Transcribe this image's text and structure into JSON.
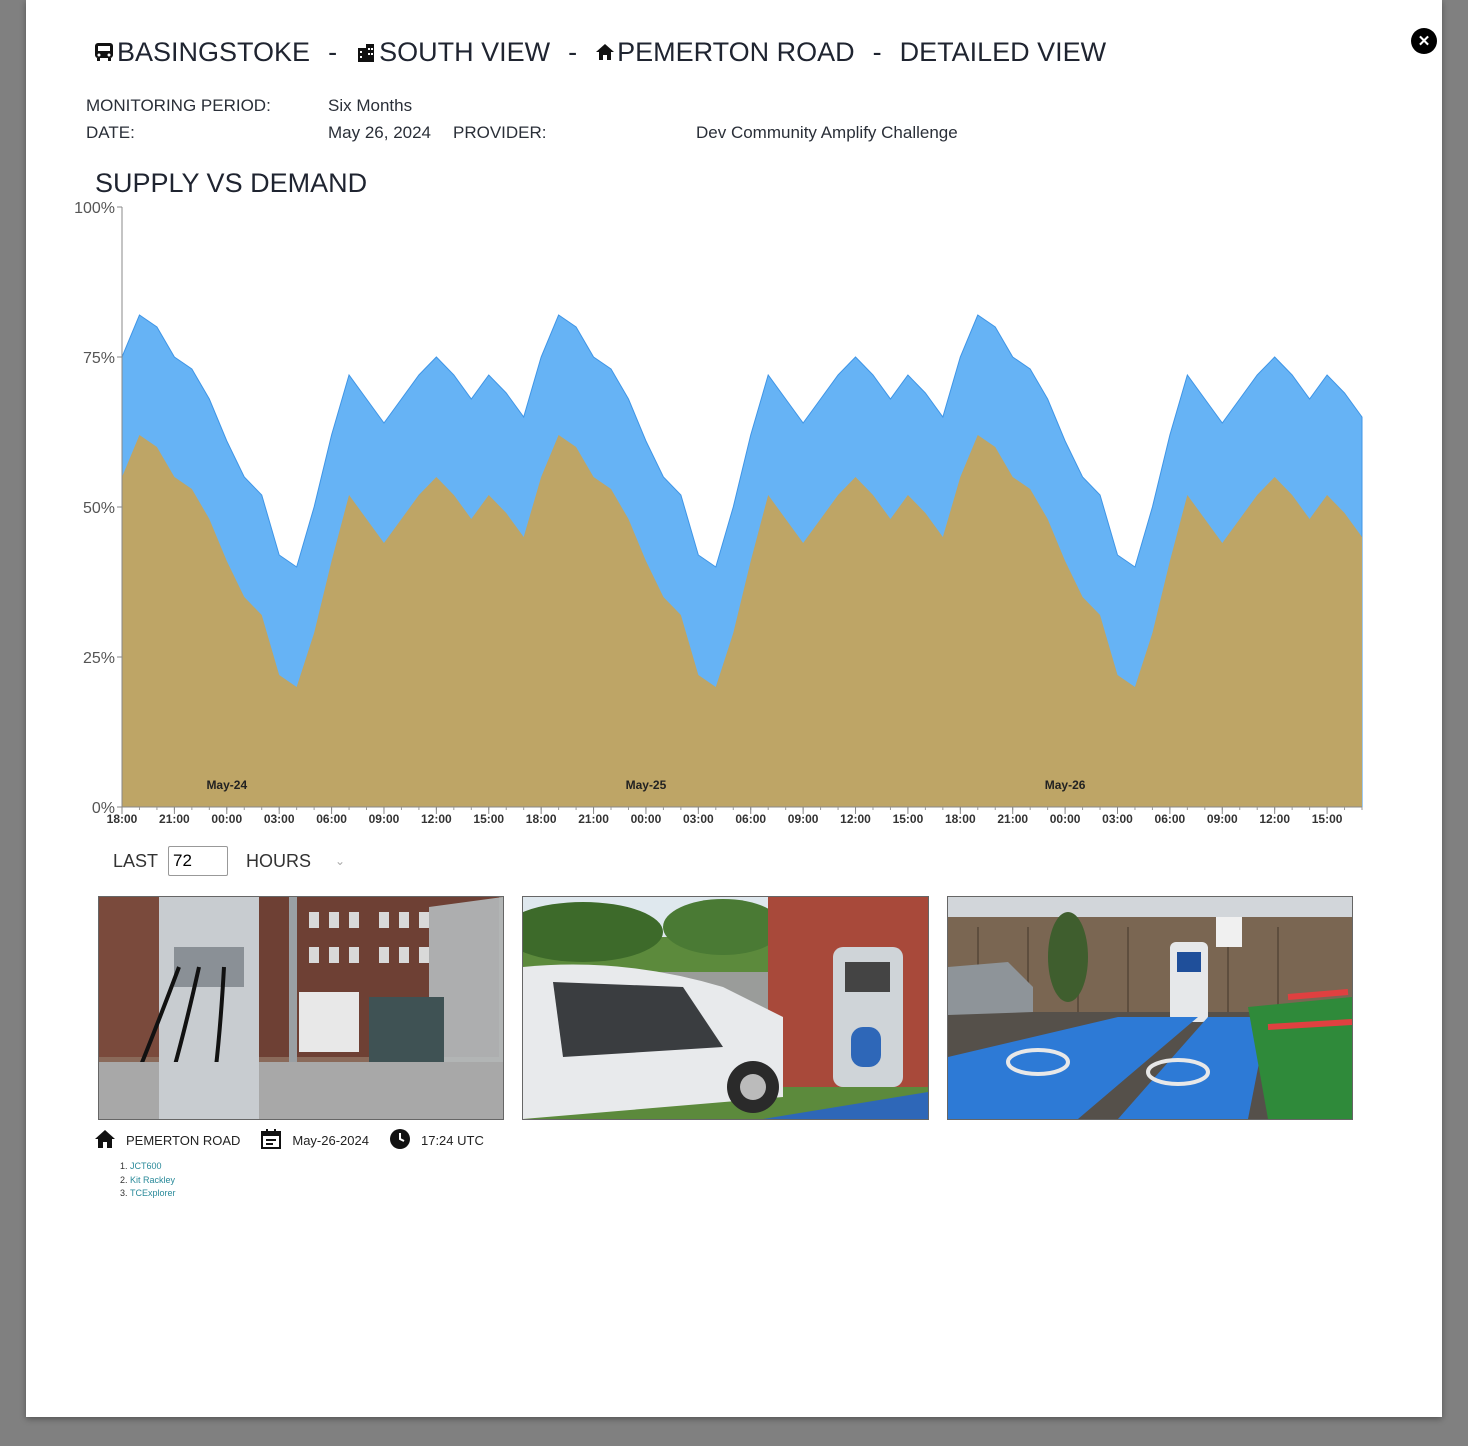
{
  "header": {
    "crumbs": [
      {
        "label": "BASINGSTOKE",
        "icon": "bus-icon"
      },
      {
        "label": "SOUTH VIEW",
        "icon": "city-icon"
      },
      {
        "label": "PEMERTON ROAD",
        "icon": "home-icon"
      }
    ],
    "separator": "-",
    "view_label": "DETAILED VIEW",
    "close_icon": "close-icon"
  },
  "meta": {
    "monitoring_period_label": "MONITORING PERIOD:",
    "monitoring_period_value": "Six Months",
    "date_label": "DATE:",
    "date_value": "May 26, 2024",
    "provider_label": "PROVIDER:",
    "provider_value": "Dev Community Amplify Challenge"
  },
  "chart_title": "SUPPLY VS DEMAND",
  "chart_data": {
    "type": "area",
    "title": "SUPPLY VS DEMAND",
    "ylim": [
      0,
      100
    ],
    "y_ticks": [
      "0%",
      "25%",
      "50%",
      "75%",
      "100%"
    ],
    "x_ticks": [
      "18:00",
      "21:00",
      "00:00",
      "03:00",
      "06:00",
      "09:00",
      "12:00",
      "15:00",
      "18:00",
      "21:00",
      "00:00",
      "03:00",
      "06:00",
      "09:00",
      "12:00",
      "15:00",
      "18:00",
      "21:00",
      "00:00",
      "03:00",
      "06:00",
      "09:00",
      "12:00",
      "15:00"
    ],
    "day_labels": [
      {
        "label": "May-24",
        "hour": 6
      },
      {
        "label": "May-25",
        "hour": 30
      },
      {
        "label": "May-26",
        "hour": 54
      }
    ],
    "x_hours": [
      0,
      1,
      2,
      3,
      4,
      5,
      6,
      7,
      8,
      9,
      10,
      11,
      12,
      13,
      14,
      15,
      16,
      17,
      18,
      19,
      20,
      21,
      22,
      23,
      24,
      25,
      26,
      27,
      28,
      29,
      30,
      31,
      32,
      33,
      34,
      35,
      36,
      37,
      38,
      39,
      40,
      41,
      42,
      43,
      44,
      45,
      46,
      47,
      48,
      49,
      50,
      51,
      52,
      53,
      54,
      55,
      56,
      57,
      58,
      59,
      60,
      61,
      62,
      63,
      64,
      65,
      66,
      67,
      68,
      69,
      70,
      71
    ],
    "series": [
      {
        "color": "#bea566",
        "values": [
          55,
          62,
          60,
          55,
          53,
          48,
          41,
          35,
          32,
          22,
          20,
          29,
          41,
          52,
          48,
          44,
          48,
          52,
          55,
          52,
          48,
          52,
          49,
          45,
          55,
          62,
          60,
          55,
          53,
          48,
          41,
          35,
          32,
          22,
          20,
          29,
          41,
          52,
          48,
          44,
          48,
          52,
          55,
          52,
          48,
          52,
          49,
          45,
          55,
          62,
          60,
          55,
          53,
          48,
          41,
          35,
          32,
          22,
          20,
          29,
          41,
          52,
          48,
          44,
          48,
          52,
          55,
          52,
          48,
          52,
          49,
          45
        ]
      },
      {
        "color": "#66b3f5",
        "values": [
          75,
          82,
          80,
          75,
          73,
          68,
          61,
          55,
          52,
          42,
          40,
          50,
          62,
          72,
          68,
          64,
          68,
          72,
          75,
          72,
          68,
          72,
          69,
          65,
          75,
          82,
          80,
          75,
          73,
          68,
          61,
          55,
          52,
          42,
          40,
          50,
          62,
          72,
          68,
          64,
          68,
          72,
          75,
          72,
          68,
          72,
          69,
          65,
          75,
          82,
          80,
          75,
          73,
          68,
          61,
          55,
          52,
          42,
          40,
          50,
          62,
          72,
          68,
          64,
          68,
          72,
          75,
          72,
          68,
          72,
          69,
          65
        ]
      }
    ],
    "grid": false
  },
  "controls": {
    "last_label": "LAST",
    "hours_value": "72",
    "unit_label": "HOURS"
  },
  "photos": [
    {
      "name": "photo-charger-street"
    },
    {
      "name": "photo-car-charging"
    },
    {
      "name": "photo-ev-bays"
    }
  ],
  "caption": {
    "location": "PEMERTON ROAD",
    "date": "May-26-2024",
    "time": "17:24 UTC"
  },
  "credits": [
    "JCT600",
    "Kit Rackley",
    "TCExplorer"
  ]
}
